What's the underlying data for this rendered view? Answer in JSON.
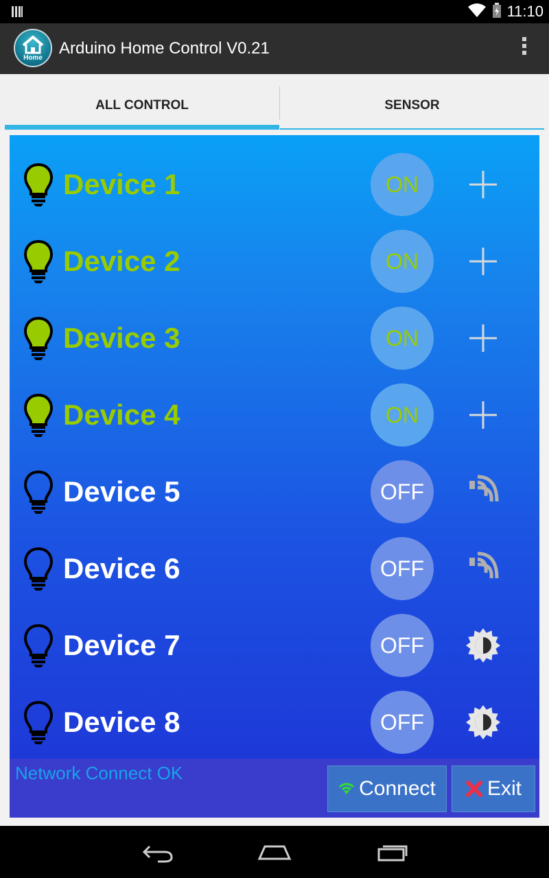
{
  "status_bar": {
    "time": "11:10"
  },
  "app": {
    "title": "Arduino Home Control V0.21",
    "icon_label": "Home"
  },
  "tabs": [
    {
      "label": "ALL CONTROL",
      "selected": true
    },
    {
      "label": "SENSOR",
      "selected": false
    }
  ],
  "devices": [
    {
      "name": "Device 1",
      "state": "ON",
      "side_icon": "plus-icon"
    },
    {
      "name": "Device 2",
      "state": "ON",
      "side_icon": "plus-icon"
    },
    {
      "name": "Device 3",
      "state": "ON",
      "side_icon": "plus-icon"
    },
    {
      "name": "Device 4",
      "state": "ON",
      "side_icon": "plus-icon"
    },
    {
      "name": "Device 5",
      "state": "OFF",
      "side_icon": "motion-sensor-icon"
    },
    {
      "name": "Device 6",
      "state": "OFF",
      "side_icon": "motion-sensor-icon"
    },
    {
      "name": "Device 7",
      "state": "OFF",
      "side_icon": "brightness-icon"
    },
    {
      "name": "Device 8",
      "state": "OFF",
      "side_icon": "brightness-icon"
    }
  ],
  "footer": {
    "status": "Network Connect OK",
    "connect_label": "Connect",
    "exit_label": "Exit"
  },
  "colors": {
    "on_text": "#99cc00",
    "off_text": "#ffffff",
    "tab_indicator": "#33b5e5",
    "status_text": "#1aa3e8"
  }
}
